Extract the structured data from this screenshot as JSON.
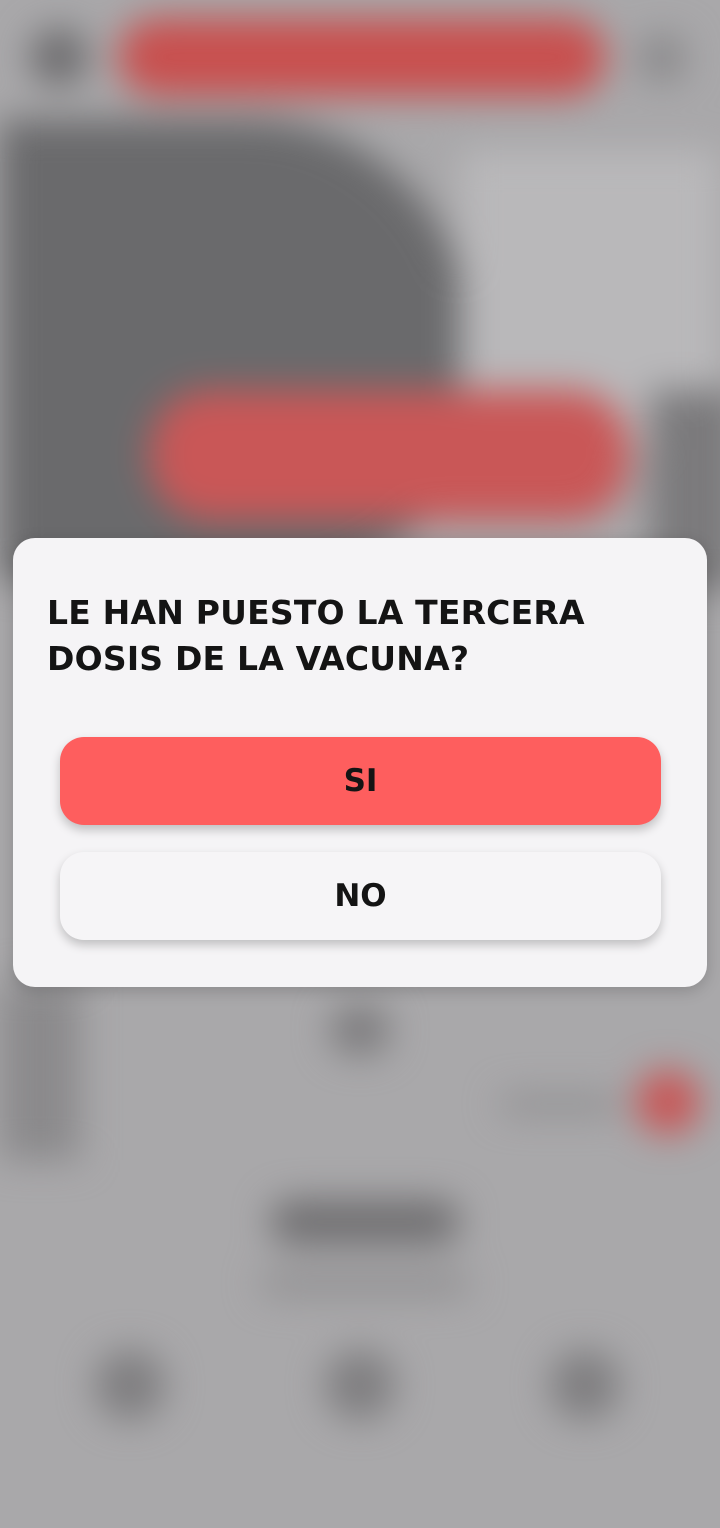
{
  "dialog": {
    "question": "LE HAN PUESTO LA TERCERA DOSIS DE LA VACUNA?",
    "buttons": {
      "yes_label": "SI",
      "no_label": "NO"
    }
  },
  "colors": {
    "accent": "#fe5e5e",
    "dialog_background": "#f5f4f6",
    "scrim": "#a9a8aa",
    "text": "#141414"
  }
}
